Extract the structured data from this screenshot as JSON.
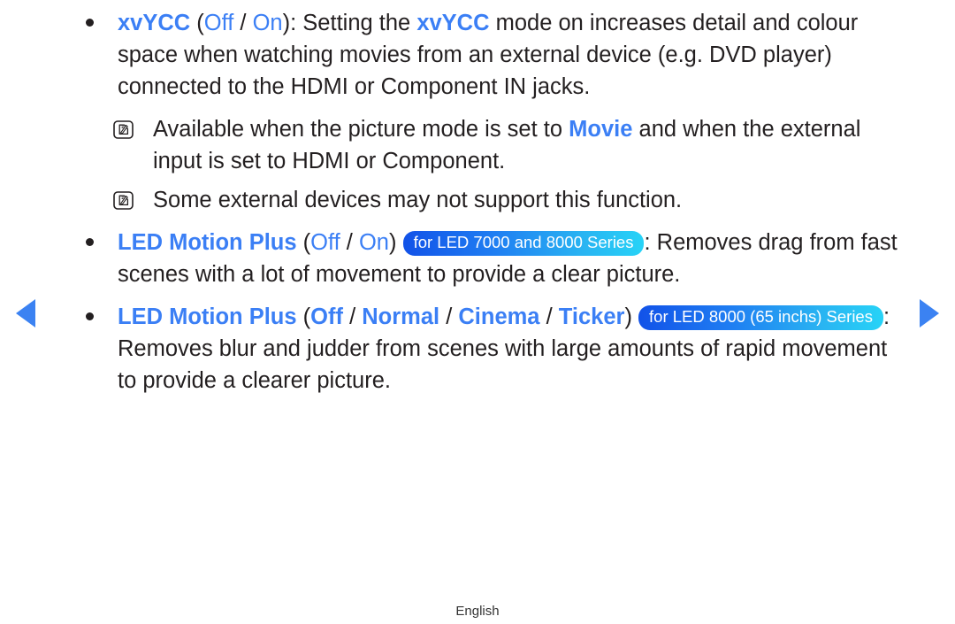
{
  "page": {
    "footer_label": "English",
    "nav": {
      "prev_label": "previous page",
      "next_label": "next page"
    }
  },
  "accent_colors": {
    "link_blue": "#3b7ff5",
    "arrow_blue": "#3b82f2",
    "badge_gradient_start": "#1252e8",
    "badge_gradient_end": "#27d3f7",
    "text_black": "#231f20"
  },
  "content": {
    "items": [
      {
        "type": "bullet",
        "id": "xvycc",
        "term": "xvYCC",
        "open_paren": " (",
        "option_1": "Off",
        "separator": " / ",
        "option_2": "On",
        "close_paren": "): ",
        "body_part_1": "Setting the ",
        "inline_term": "xvYCC",
        "body_part_2": " mode on increases detail and colour space when watching movies from an external device (e.g. DVD player) connected to the HDMI or Component IN jacks."
      },
      {
        "type": "note",
        "id": "note-movie",
        "icon": "note-pencil-icon",
        "text_part_1": "Available when the picture mode is set to ",
        "highlight": "Movie",
        "text_part_2": " and when the external input is set to HDMI or Component."
      },
      {
        "type": "note",
        "id": "note-support",
        "icon": "note-pencil-icon",
        "text_part_1": "Some external devices may not support this function.",
        "highlight": "",
        "text_part_2": ""
      },
      {
        "type": "bullet",
        "id": "led-motion-plus-1",
        "term": "LED Motion Plus",
        "open_paren": " (",
        "option_1": "Off",
        "separator": " / ",
        "option_2": "On",
        "close_paren": ") ",
        "badge": "for LED 7000 and 8000 Series",
        "body_part_1": ": Removes drag from fast scenes with a lot of movement to provide a clear picture.",
        "inline_term": "",
        "body_part_2": ""
      },
      {
        "type": "bullet",
        "id": "led-motion-plus-2",
        "term": "LED Motion Plus",
        "open_paren": " (",
        "option_1": "Off",
        "separator": " / ",
        "option_2": "Normal",
        "separator_2": " / ",
        "option_3": "Cinema",
        "separator_3": " / ",
        "option_4": "Ticker",
        "close_paren": ") ",
        "badge": "for LED 8000 (65 inchs) Series",
        "body_part_1": ": Removes blur and judder from scenes with large amounts of rapid movement to provide a clearer picture.",
        "inline_term": "",
        "body_part_2": ""
      }
    ]
  }
}
